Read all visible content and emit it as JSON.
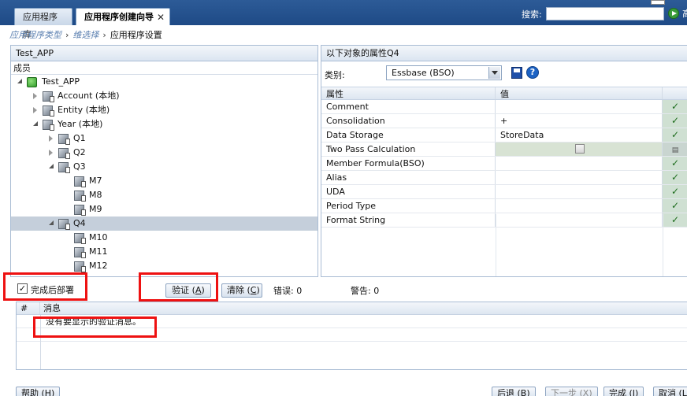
{
  "tabs": [
    {
      "label": "应用程序库"
    },
    {
      "label": "应用程序创建向导",
      "close": "✕"
    }
  ],
  "search": {
    "label": "搜索:",
    "placeholder": "",
    "cut_text": "高"
  },
  "breadcrumb": {
    "items": [
      "应用程序类型",
      "维选择",
      "应用程序设置"
    ],
    "sep": "›"
  },
  "left_panel": {
    "title": "Test_APP",
    "members_label": "成员",
    "tree": [
      {
        "label": "Test_APP",
        "level": 0,
        "state": "expanded",
        "icon": "root-cube-icon"
      },
      {
        "label": "Account (本地)",
        "level": 1,
        "state": "collapsed",
        "icon": "account-dimension-icon"
      },
      {
        "label": "Entity (本地)",
        "level": 1,
        "state": "collapsed",
        "icon": "entity-dimension-icon"
      },
      {
        "label": "Year (本地)",
        "level": 1,
        "state": "expanded",
        "icon": "year-dimension-icon"
      },
      {
        "label": "Q1",
        "level": 2,
        "state": "collapsed",
        "icon": "member-cube-icon"
      },
      {
        "label": "Q2",
        "level": 2,
        "state": "collapsed",
        "icon": "member-cube-icon"
      },
      {
        "label": "Q3",
        "level": 2,
        "state": "expanded",
        "icon": "member-cube-icon"
      },
      {
        "label": "M7",
        "level": 3,
        "state": "leaf",
        "icon": "member-cube-icon"
      },
      {
        "label": "M8",
        "level": 3,
        "state": "leaf",
        "icon": "member-cube-icon"
      },
      {
        "label": "M9",
        "level": 3,
        "state": "leaf",
        "icon": "member-cube-icon"
      },
      {
        "label": "Q4",
        "level": 2,
        "state": "expanded",
        "icon": "member-cube-icon",
        "selected": true
      },
      {
        "label": "M10",
        "level": 3,
        "state": "leaf",
        "icon": "member-cube-icon"
      },
      {
        "label": "M11",
        "level": 3,
        "state": "leaf",
        "icon": "member-cube-icon"
      },
      {
        "label": "M12",
        "level": 3,
        "state": "leaf",
        "icon": "member-cube-icon"
      }
    ]
  },
  "right_panel": {
    "title": "以下对象的属性Q4",
    "category_label": "类别:",
    "category_value": "Essbase (BSO)",
    "col_property": "属性",
    "col_value": "值",
    "properties": [
      {
        "name": "Comment",
        "value": "",
        "status": "check"
      },
      {
        "name": "Consolidation",
        "value": "+",
        "status": "check"
      },
      {
        "name": "Data Storage",
        "value": "StoreData",
        "status": "check"
      },
      {
        "name": "Two Pass Calculation",
        "value": "",
        "status": "grid",
        "shaded": true
      },
      {
        "name": "Member Formula(BSO)",
        "value": "",
        "status": "check"
      },
      {
        "name": "Alias",
        "value": "",
        "status": "check"
      },
      {
        "name": "UDA",
        "value": "",
        "status": "check"
      },
      {
        "name": "Period Type",
        "value": "",
        "status": "check"
      },
      {
        "name": "Format String",
        "value": "",
        "status": "check"
      }
    ]
  },
  "validation": {
    "deploy_label": "完成后部署",
    "deploy_checked": true,
    "validate_label": "验证",
    "validate_key": "A",
    "clear_label": "清除",
    "clear_key": "C",
    "errors_label": "错误: 0",
    "warnings_label": "警告: 0"
  },
  "messages": {
    "col_num": "#",
    "col_msg": "消息",
    "rows": [
      "没有要显示的验证消息。"
    ]
  },
  "footer": {
    "help": "帮助 (H)",
    "back": "后退 (B)",
    "next": "下一步 (X)",
    "finish": "完成 (I)",
    "cancel": "取消 (L)"
  }
}
